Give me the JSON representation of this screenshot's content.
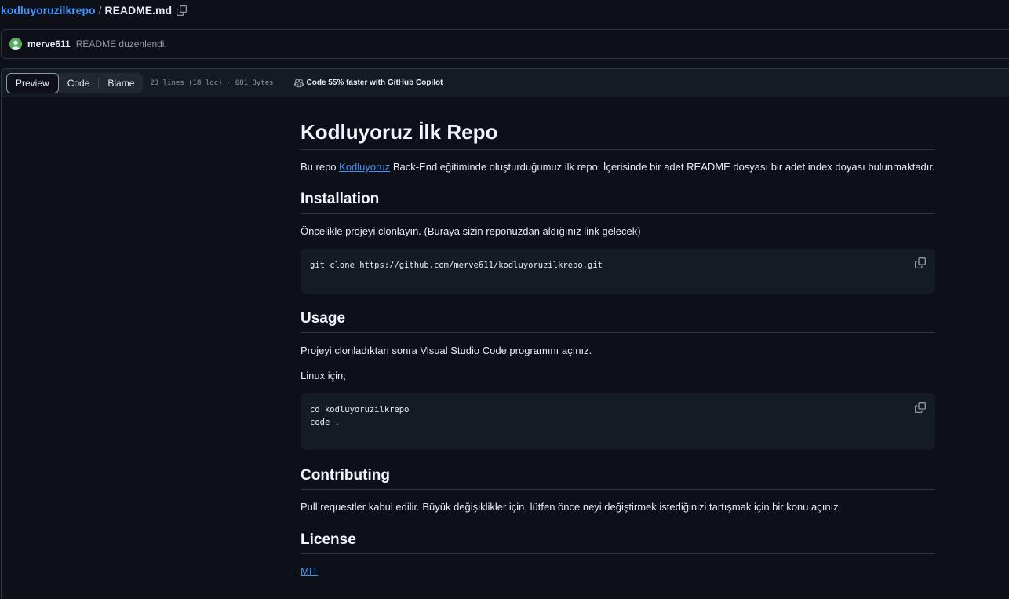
{
  "breadcrumb": {
    "repo": "kodluyoruzilkrepo",
    "separator": "/",
    "file": "README.md"
  },
  "commit": {
    "author": "merve611",
    "message": "README duzenlendi."
  },
  "file_header": {
    "tabs": [
      "Preview",
      "Code",
      "Blame"
    ],
    "active_tab": "Preview",
    "info": "23 lines (18 loc) · 681 Bytes",
    "copilot": "Code 55% faster with GitHub Copilot"
  },
  "readme": {
    "title": "Kodluyoruz İlk Repo",
    "intro_before": "Bu repo ",
    "intro_link": "Kodluyoruz",
    "intro_after": " Back-End eğitiminde oluşturduğumuz ilk repo. İçerisinde bir adet README dosyası bir adet index doyası bulunmaktadır.",
    "installation": {
      "heading": "Installation",
      "text": "Öncelikle projeyi clonlayın. (Buraya sizin reponuzdan aldığınız link gelecek)",
      "code": "git clone https://github.com/merve611/kodluyoruzilkrepo.git"
    },
    "usage": {
      "heading": "Usage",
      "text": "Projeyi clonladıktan sonra Visual Studio Code programını açınız.",
      "linux": "Linux için;",
      "code": "cd kodluyoruzilkrepo\ncode ."
    },
    "contributing": {
      "heading": "Contributing",
      "text": "Pull requestler kabul edilir. Büyük değişiklikler için, lütfen önce neyi değiştirmek istediğinizi tartışmak için bir konu açınız."
    },
    "license": {
      "heading": "License",
      "link": "MIT"
    }
  },
  "colors": {
    "background": "#0d1117",
    "link": "#4493f8",
    "border": "#30363d",
    "code_bg": "#151b23"
  }
}
